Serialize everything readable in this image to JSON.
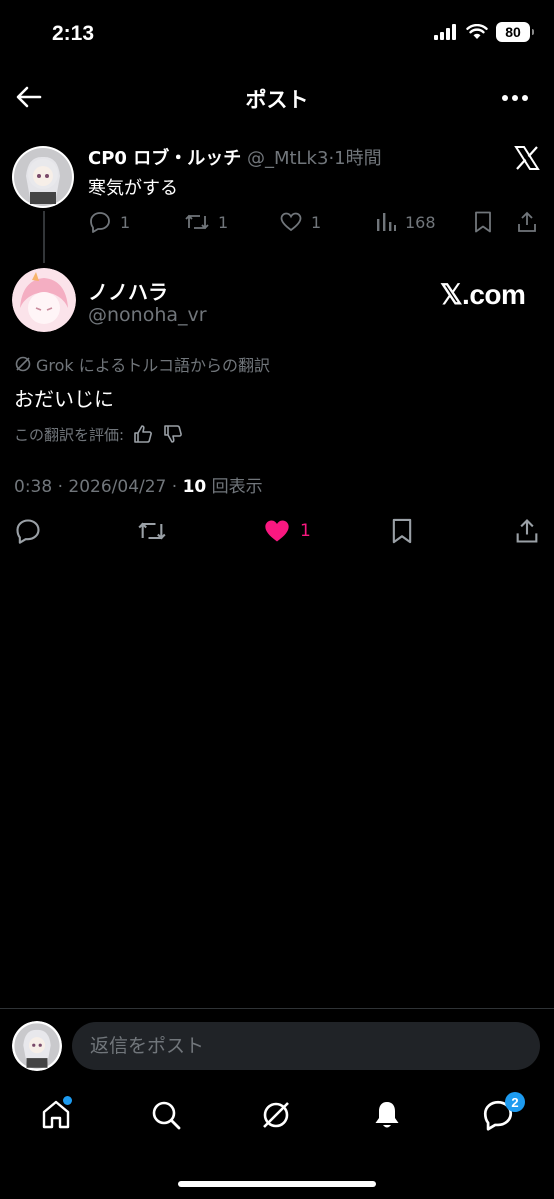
{
  "status_bar": {
    "time": "2:13",
    "battery": "80"
  },
  "nav": {
    "title": "ポスト"
  },
  "parent_post": {
    "name": "CP0 ロブ・ルッチ",
    "handle": "@_MtLk3",
    "sep": "·",
    "time": "1時間",
    "text": "寒気がする",
    "replies": "1",
    "reposts": "1",
    "likes": "1",
    "views": "168"
  },
  "main_post": {
    "name": "ノノハラ",
    "handle": "@nonoha_vr",
    "watermark": "𝕏.com",
    "translation_note": "Grok によるトルコ語からの翻訳",
    "translation": "おだいじに",
    "rate_label": "この翻訳を評価:",
    "timestamp": "0:38 · 2026/04/27 · ",
    "view_count": "10",
    "view_label": " 回表示",
    "likes": "1"
  },
  "reply": {
    "placeholder": "返信をポスト"
  },
  "tabs": {
    "messages_badge": "2"
  },
  "colors": {
    "like": "#f91880",
    "accent": "#1d9bf0",
    "muted": "#71767b"
  },
  "icons": [
    "back-arrow-icon",
    "more-icon",
    "x-logo-icon",
    "reply-icon",
    "repost-icon",
    "heart-icon",
    "views-icon",
    "bookmark-icon",
    "share-icon",
    "grok-icon",
    "thumbs-up-icon",
    "thumbs-down-icon",
    "home-icon",
    "search-icon",
    "grok-tab-icon",
    "bell-icon",
    "messages-icon"
  ]
}
